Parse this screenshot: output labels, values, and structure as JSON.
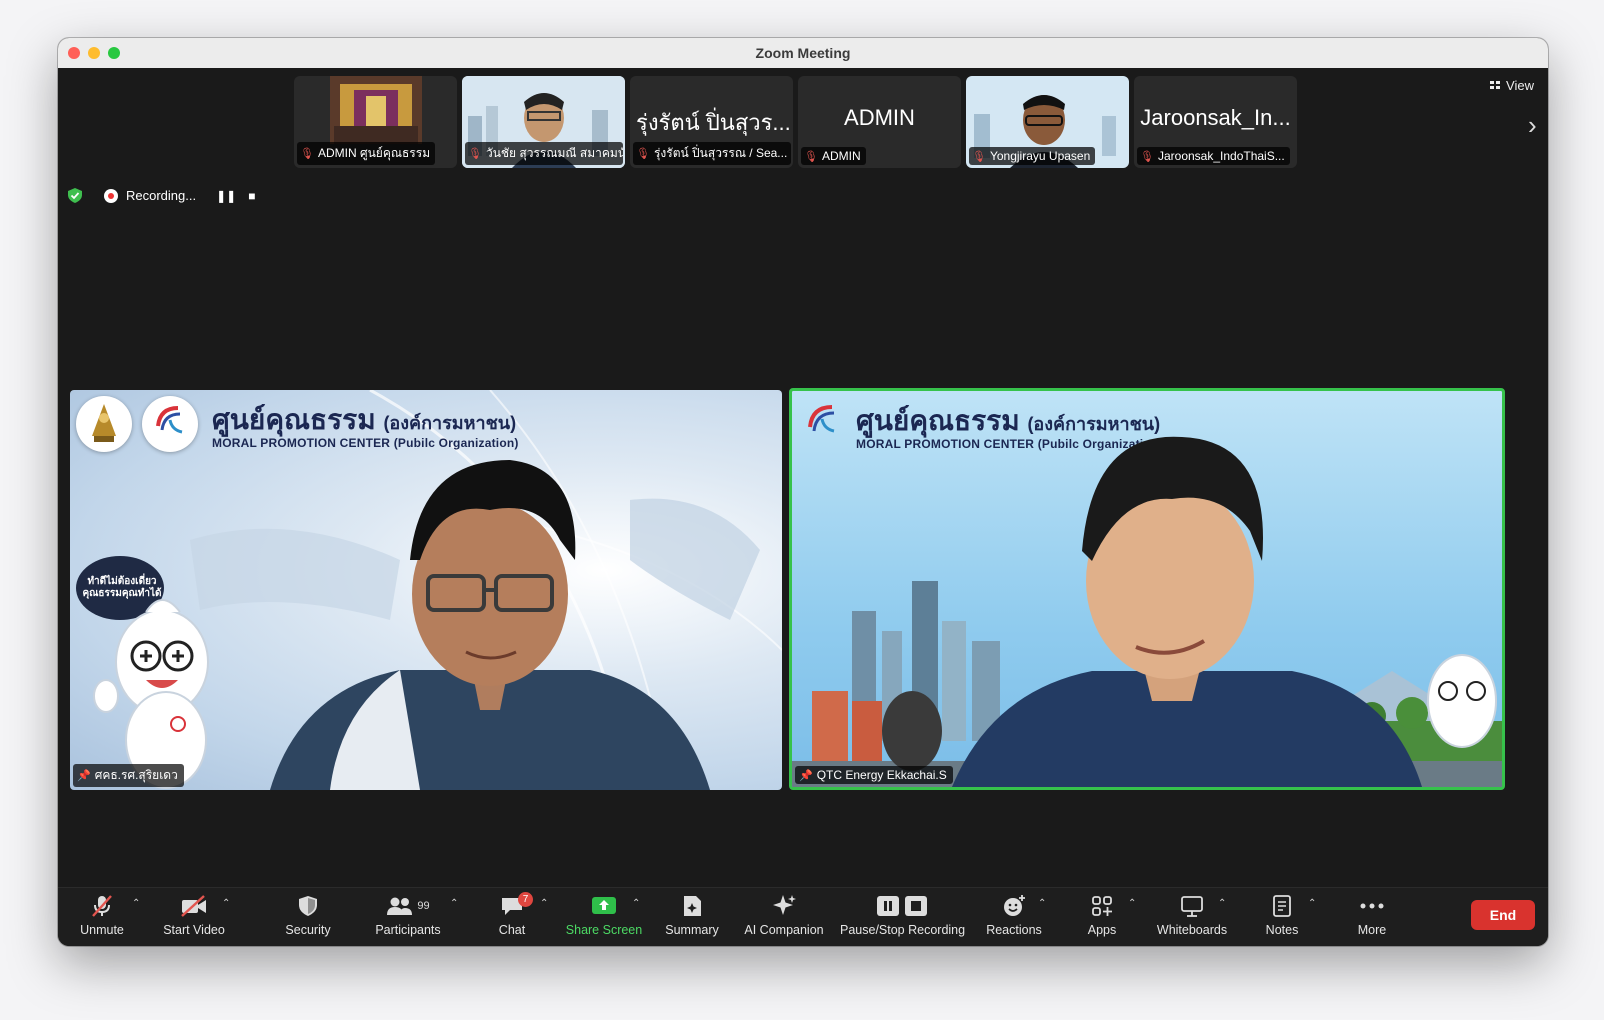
{
  "window": {
    "title": "Zoom Meeting"
  },
  "strip": {
    "thumbnails": [
      {
        "name": "ADMIN ศูนย์คุณธรรม",
        "big": ""
      },
      {
        "name": "วันชัย สุวรรณมณี สมาคมนัก...",
        "big": ""
      },
      {
        "name": "รุ่งรัตน์ ปิ่นสุวรรณ / Sea...",
        "big": "รุ่งรัตน์ ปิ่นสุวร..."
      },
      {
        "name": "ADMIN",
        "big": "ADMIN"
      },
      {
        "name": "Yongjirayu Upasen",
        "big": ""
      },
      {
        "name": "Jaroonsak_IndoThaiS...",
        "big": "Jaroonsak_In..."
      }
    ],
    "view_label": "View"
  },
  "recording": {
    "label": "Recording...",
    "pause": "❚❚",
    "stop": "■"
  },
  "tiles": [
    {
      "name": "ศคธ.รศ.สุริยเดว",
      "banner_title": "ศูนย์คุณธรรม",
      "banner_title_suffix": "(องค์การมหาชน)",
      "banner_sub": "MORAL PROMOTION CENTER  (Pubilc Organization)",
      "bubble": "ทำดีไม่ต้องเดี่ยว คุณธรรมคุณทำได้"
    },
    {
      "name": "QTC Energy Ekkachai.S",
      "banner_title": "ศูนย์คุณธรรม",
      "banner_title_suffix": "(องค์การมหาชน)",
      "banner_sub": "MORAL PROMOTION CENTER  (Pubilc Organization)"
    }
  ],
  "toolbar": {
    "unmute": "Unmute",
    "start_video": "Start Video",
    "security": "Security",
    "participants": "Participants",
    "participants_count": "99",
    "chat": "Chat",
    "chat_badge": "7",
    "share_screen": "Share Screen",
    "summary": "Summary",
    "ai_companion": "AI Companion",
    "pause_stop_recording": "Pause/Stop Recording",
    "reactions": "Reactions",
    "apps": "Apps",
    "whiteboards": "Whiteboards",
    "notes": "Notes",
    "more": "More",
    "end": "End"
  },
  "colors": {
    "active_speaker": "#36c24b",
    "end_button": "#d9332e",
    "share_green": "#4cd964"
  }
}
